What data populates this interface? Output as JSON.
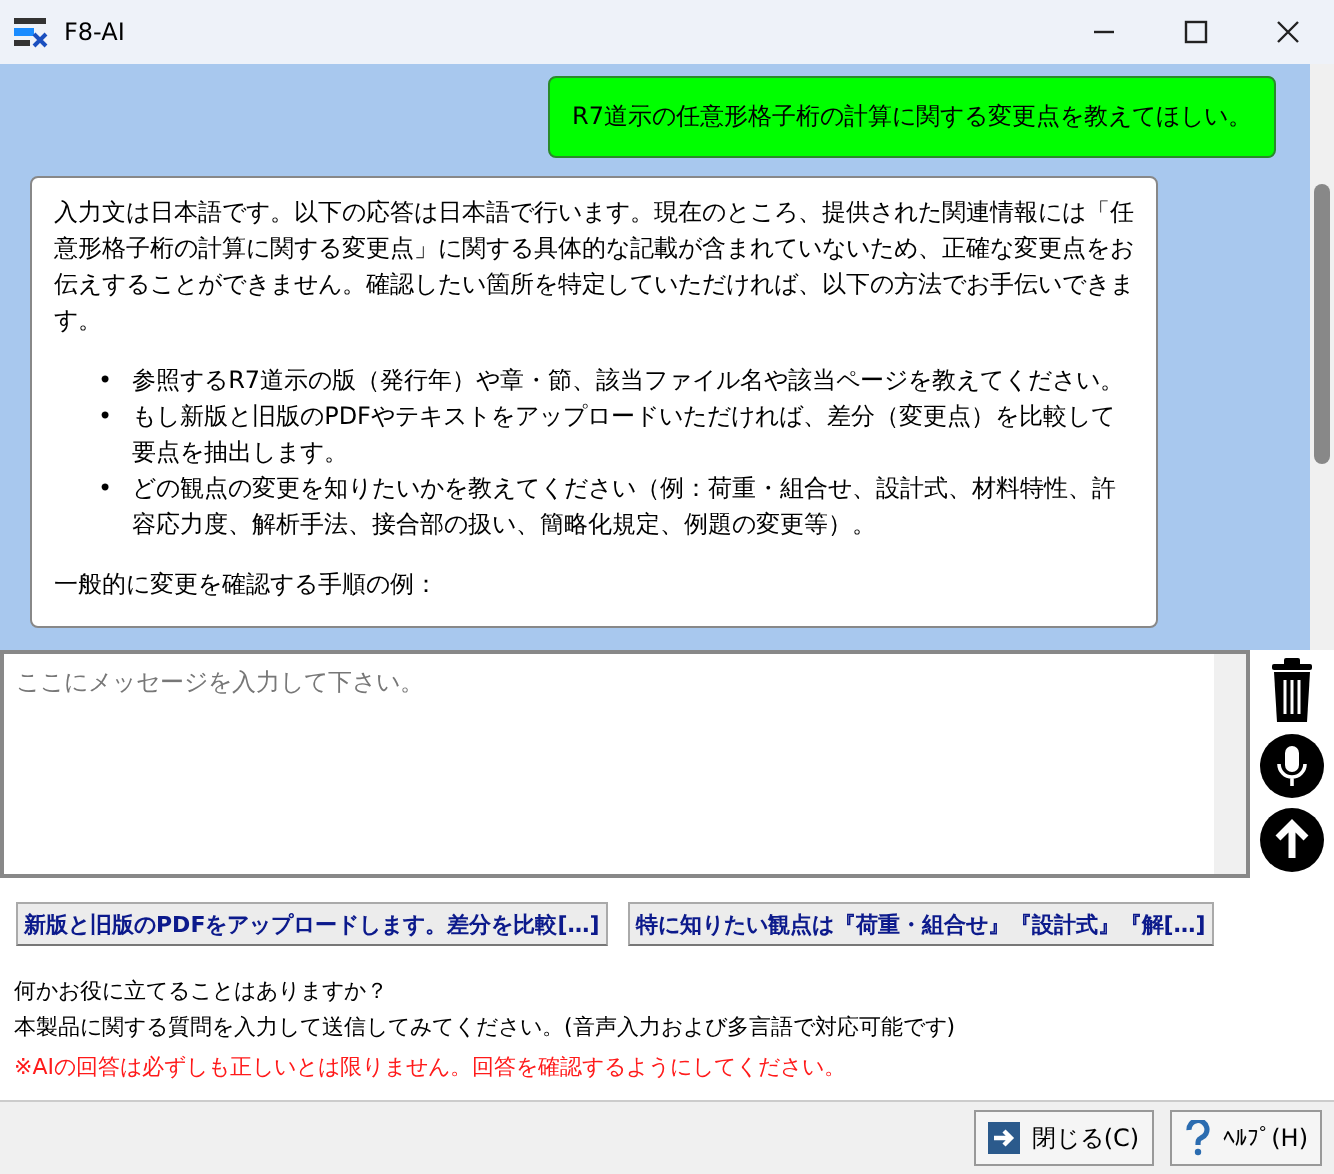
{
  "window": {
    "title": "F8-AI"
  },
  "chat": {
    "user_message": "R7道示の任意形格子桁の計算に関する変更点を教えてほしい。",
    "answer": {
      "paragraphs": [
        "入力文は日本語です。以下の応答は日本語で行います。現在のところ、提供された関連情報には「任意形格子桁の計算に関する変更点」に関する具体的な記載が含まれていないため、正確な変更点をお伝えすることができません。確認したい箇所を特定していただければ、以下の方法でお手伝いできます。"
      ],
      "bullets": [
        {
          "marker": "•",
          "text": "参照するR7道示の版（発行年）や章・節、該当ファイル名や該当ページを教えてください。"
        },
        {
          "marker": "•",
          "text": "もし新版と旧版のPDFやテキストをアップロードいただければ、差分（変更点）を比較して要点を抽出します。"
        },
        {
          "marker": "•",
          "text": "どの観点の変更を知りたいかを教えてください（例：荷重・組合せ、設計式、材料特性、許容応力度、解析手法、接合部の扱い、簡略化規定、例題の変更等）。"
        }
      ],
      "after": "一般的に変更を確認する手順の例："
    }
  },
  "input": {
    "placeholder": "ここにメッセージを入力して下さい。"
  },
  "suggestions": [
    "新版と旧版のPDFをアップロードします。差分を比較[…]",
    "特に知りたい観点は『荷重・組合せ』『設計式』『解[…]"
  ],
  "info": {
    "lines": [
      "何かお役に立てることはありますか？",
      "本製品に関する質問を入力して送信してみてください。(音声入力および多言語で対応可能です)"
    ],
    "warning": "※AIの回答は必ずしも正しいとは限りません。回答を確認するようにしてください。"
  },
  "buttons": [
    {
      "kind": "close",
      "label": "閉じる(C)"
    },
    {
      "kind": "help",
      "label": "ﾍﾙﾌﾟ(H)"
    }
  ]
}
